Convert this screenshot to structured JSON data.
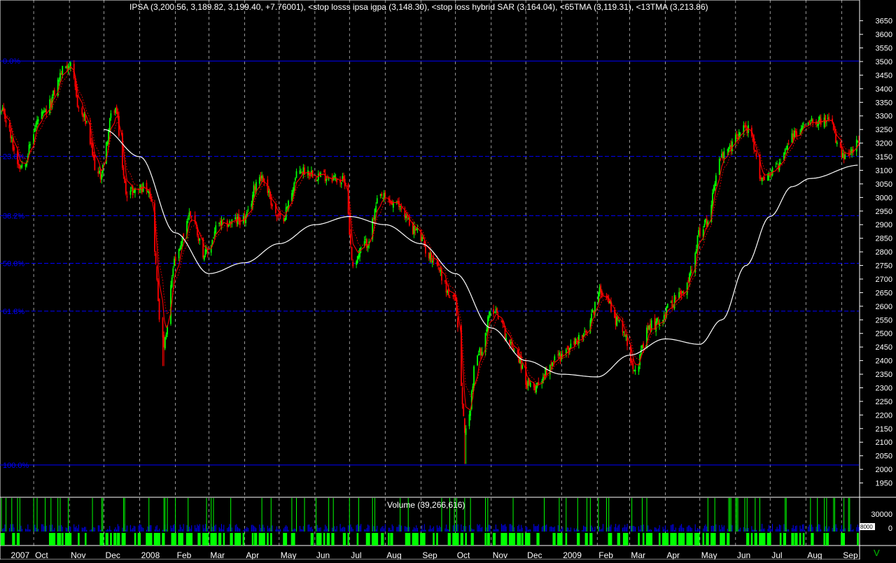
{
  "chart_data": {
    "type": "candlestick",
    "header_text": "IPSA (3,200.56, 3,189.82, 3,199.40, +7.76001), <stop losss ipsa igpa (3,148.30), <stop loss hybrid SAR (3,164.04), <65TMA (3,119.31), <13TMA (3,213.86)",
    "price_axis": {
      "ylim": [
        1900,
        3680
      ],
      "ticks": [
        1950,
        2000,
        2050,
        2100,
        2150,
        2200,
        2250,
        2300,
        2350,
        2400,
        2450,
        2500,
        2550,
        2600,
        2650,
        2700,
        2750,
        2800,
        2850,
        2900,
        2950,
        3000,
        3050,
        3100,
        3150,
        3200,
        3250,
        3300,
        3350,
        3400,
        3450,
        3500,
        3550,
        3600,
        3650
      ]
    },
    "volume_axis": {
      "ticks": [
        "30000",
        "0"
      ],
      "box_label": "8000"
    },
    "volume_title": "Volume (39,266,616)",
    "fib_levels": [
      {
        "label": "0.0%",
        "value": 3502
      },
      {
        "label": "23.6%",
        "value": 3151
      },
      {
        "label": "38.2%",
        "value": 2933
      },
      {
        "label": "50.0%",
        "value": 2758
      },
      {
        "label": "61.8%",
        "value": 2582
      },
      {
        "label": "100.0%",
        "value": 2016
      }
    ],
    "x_labels": [
      {
        "label": "2007",
        "date": "2007-09-10"
      },
      {
        "label": "Oct",
        "date": "2007-10-01"
      },
      {
        "label": "Nov",
        "date": "2007-11-01"
      },
      {
        "label": "Dec",
        "date": "2007-12-01"
      },
      {
        "label": "2008",
        "date": "2008-01-01"
      },
      {
        "label": "Feb",
        "date": "2008-02-01"
      },
      {
        "label": "Mar",
        "date": "2008-03-01"
      },
      {
        "label": "Apr",
        "date": "2008-04-01"
      },
      {
        "label": "May",
        "date": "2008-05-01"
      },
      {
        "label": "Jun",
        "date": "2008-06-01"
      },
      {
        "label": "Jul",
        "date": "2008-07-01"
      },
      {
        "label": "Aug",
        "date": "2008-08-01"
      },
      {
        "label": "Sep",
        "date": "2008-09-01"
      },
      {
        "label": "Oct",
        "date": "2008-10-01"
      },
      {
        "label": "Nov",
        "date": "2008-11-01"
      },
      {
        "label": "Dec",
        "date": "2008-12-01"
      },
      {
        "label": "2009",
        "date": "2009-01-01"
      },
      {
        "label": "Feb",
        "date": "2009-02-01"
      },
      {
        "label": "Mar",
        "date": "2009-03-01"
      },
      {
        "label": "Apr",
        "date": "2009-04-01"
      },
      {
        "label": "May",
        "date": "2009-05-01"
      },
      {
        "label": "Jun",
        "date": "2009-06-01"
      },
      {
        "label": "Jul",
        "date": "2009-07-01"
      },
      {
        "label": "Aug",
        "date": "2009-08-01"
      },
      {
        "label": "Sep",
        "date": "2009-09-01"
      }
    ],
    "date_range": [
      "2007-09-03",
      "2009-09-16"
    ],
    "close_keypoints": [
      [
        "2007-09-03",
        3310
      ],
      [
        "2007-09-20",
        3120
      ],
      [
        "2007-10-08",
        3300
      ],
      [
        "2007-10-31",
        3490
      ],
      [
        "2007-11-12",
        3300
      ],
      [
        "2007-11-27",
        3080
      ],
      [
        "2007-12-10",
        3330
      ],
      [
        "2007-12-21",
        3020
      ],
      [
        "2008-01-08",
        3040
      ],
      [
        "2008-01-22",
        2460
      ],
      [
        "2008-02-01",
        2770
      ],
      [
        "2008-02-14",
        2940
      ],
      [
        "2008-02-27",
        2790
      ],
      [
        "2008-03-10",
        2900
      ],
      [
        "2008-04-01",
        2920
      ],
      [
        "2008-04-14",
        3080
      ],
      [
        "2008-05-02",
        2920
      ],
      [
        "2008-05-20",
        3100
      ],
      [
        "2008-06-10",
        3080
      ],
      [
        "2008-06-27",
        3060
      ],
      [
        "2008-07-04",
        2760
      ],
      [
        "2008-07-15",
        2830
      ],
      [
        "2008-07-28",
        3000
      ],
      [
        "2008-08-12",
        2970
      ],
      [
        "2008-08-27",
        2880
      ],
      [
        "2008-09-10",
        2780
      ],
      [
        "2008-09-30",
        2620
      ],
      [
        "2008-10-10",
        2140
      ],
      [
        "2008-10-20",
        2420
      ],
      [
        "2008-11-03",
        2590
      ],
      [
        "2008-11-20",
        2450
      ],
      [
        "2008-12-05",
        2300
      ],
      [
        "2008-12-31",
        2420
      ],
      [
        "2009-01-20",
        2490
      ],
      [
        "2009-02-05",
        2660
      ],
      [
        "2009-02-20",
        2540
      ],
      [
        "2009-03-06",
        2380
      ],
      [
        "2009-03-20",
        2530
      ],
      [
        "2009-04-15",
        2640
      ],
      [
        "2009-05-05",
        2900
      ],
      [
        "2009-05-20",
        3150
      ],
      [
        "2009-06-10",
        3260
      ],
      [
        "2009-06-25",
        3070
      ],
      [
        "2009-07-08",
        3120
      ],
      [
        "2009-07-22",
        3230
      ],
      [
        "2009-08-05",
        3290
      ],
      [
        "2009-08-20",
        3280
      ],
      [
        "2009-09-04",
        3140
      ],
      [
        "2009-09-16",
        3199
      ]
    ],
    "sma_keypoints": [
      [
        "2007-12-01",
        3250
      ],
      [
        "2008-01-01",
        3150
      ],
      [
        "2008-02-01",
        2870
      ],
      [
        "2008-03-01",
        2720
      ],
      [
        "2008-04-01",
        2760
      ],
      [
        "2008-05-01",
        2830
      ],
      [
        "2008-06-01",
        2900
      ],
      [
        "2008-07-01",
        2930
      ],
      [
        "2008-08-01",
        2900
      ],
      [
        "2008-09-01",
        2830
      ],
      [
        "2008-10-01",
        2720
      ],
      [
        "2008-11-01",
        2520
      ],
      [
        "2008-12-01",
        2400
      ],
      [
        "2009-01-01",
        2350
      ],
      [
        "2009-02-01",
        2340
      ],
      [
        "2009-03-01",
        2420
      ],
      [
        "2009-04-01",
        2480
      ],
      [
        "2009-05-01",
        2460
      ],
      [
        "2009-05-20",
        2550
      ],
      [
        "2009-06-10",
        2750
      ],
      [
        "2009-07-01",
        2930
      ],
      [
        "2009-07-20",
        3040
      ],
      [
        "2009-08-05",
        3070
      ],
      [
        "2009-09-16",
        3119
      ]
    ],
    "colors": {
      "up": "#00ff00",
      "down": "#ff0000",
      "sma": "#ffffff",
      "trail": "#ff0000",
      "fib": "#0000ff",
      "fib_label": "#0000ff",
      "grid": "#ffffff",
      "volume_bar": "#0000ff",
      "volume_spike": "#00ff00",
      "strip_on": "#00ff00",
      "frame": "#ffffff"
    },
    "corner_mark": "V"
  }
}
